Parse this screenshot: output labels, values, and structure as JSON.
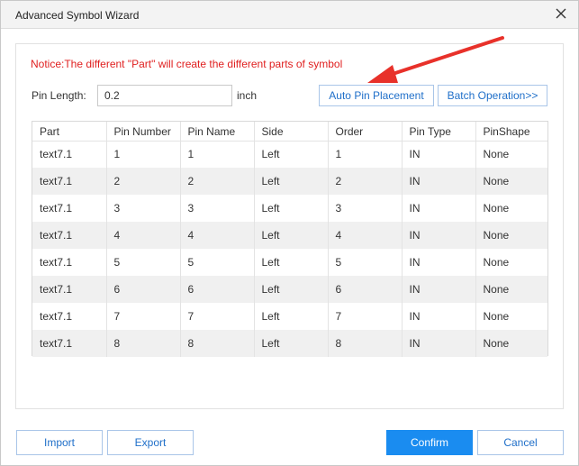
{
  "window": {
    "title": "Advanced Symbol Wizard",
    "close_icon": "close-icon"
  },
  "notice": "Notice:The different \"Part\" will create the different parts of symbol",
  "pin_length": {
    "label": "Pin Length:",
    "value": "0.2",
    "unit": "inch"
  },
  "actions": {
    "auto_pin_placement": "Auto Pin Placement",
    "batch_operation": "Batch Operation>>"
  },
  "table": {
    "columns": [
      "Part",
      "Pin Number",
      "Pin Name",
      "Side",
      "Order",
      "Pin Type",
      "PinShape"
    ],
    "rows": [
      [
        "text7.1",
        "1",
        "1",
        "Left",
        "1",
        "IN",
        "None"
      ],
      [
        "text7.1",
        "2",
        "2",
        "Left",
        "2",
        "IN",
        "None"
      ],
      [
        "text7.1",
        "3",
        "3",
        "Left",
        "3",
        "IN",
        "None"
      ],
      [
        "text7.1",
        "4",
        "4",
        "Left",
        "4",
        "IN",
        "None"
      ],
      [
        "text7.1",
        "5",
        "5",
        "Left",
        "5",
        "IN",
        "None"
      ],
      [
        "text7.1",
        "6",
        "6",
        "Left",
        "6",
        "IN",
        "None"
      ],
      [
        "text7.1",
        "7",
        "7",
        "Left",
        "7",
        "IN",
        "None"
      ],
      [
        "text7.1",
        "8",
        "8",
        "Left",
        "8",
        "IN",
        "None"
      ]
    ]
  },
  "footer": {
    "import": "Import",
    "export": "Export",
    "confirm": "Confirm",
    "cancel": "Cancel"
  },
  "colors": {
    "notice": "#e02020",
    "accent": "#1a8cf0",
    "link_text": "#1f6fc9",
    "annotation_arrow": "#e8312a"
  }
}
